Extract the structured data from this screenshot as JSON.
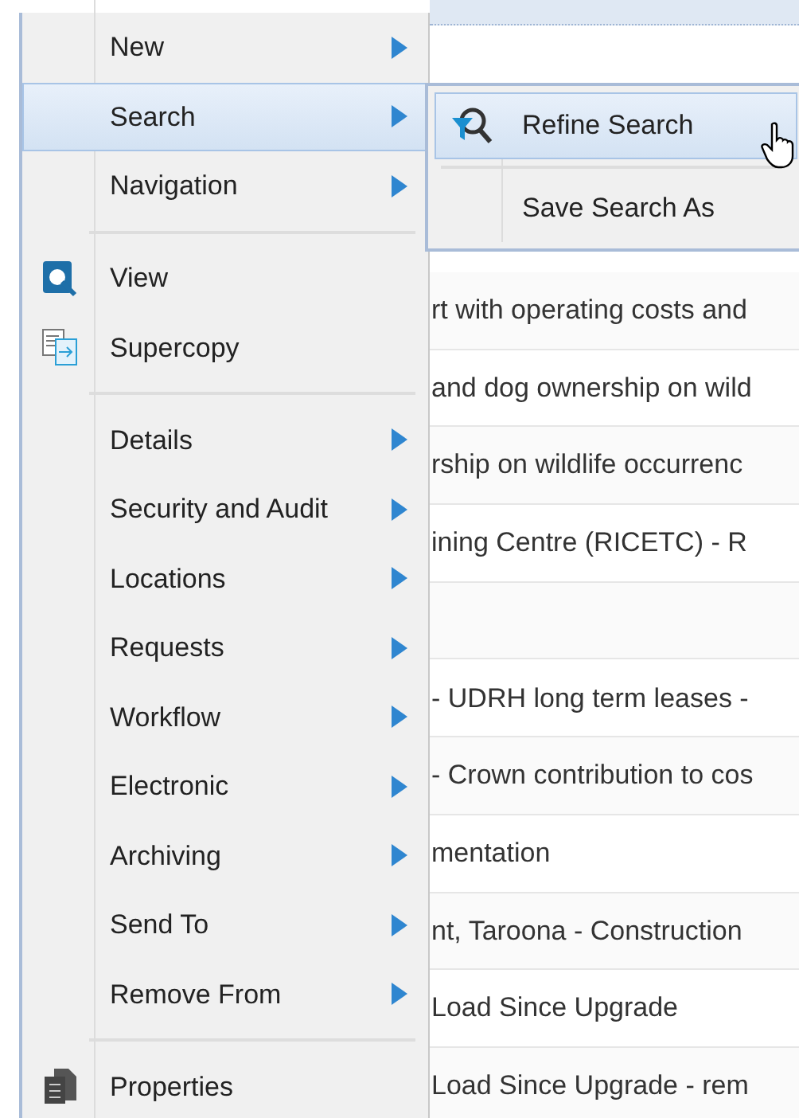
{
  "menu": {
    "items": [
      {
        "kind": "item",
        "label": "New",
        "submenu": true,
        "selected": false
      },
      {
        "kind": "item",
        "label": "Search",
        "submenu": true,
        "selected": true
      },
      {
        "kind": "item",
        "label": "Navigation",
        "submenu": true,
        "selected": false
      },
      {
        "kind": "separator"
      },
      {
        "kind": "view",
        "label": "View",
        "submenu": false,
        "selected": false
      },
      {
        "kind": "copy",
        "label": "Supercopy",
        "submenu": false,
        "selected": false
      },
      {
        "kind": "separator"
      },
      {
        "kind": "item",
        "label": "Details",
        "submenu": true,
        "selected": false
      },
      {
        "kind": "item",
        "label": "Security and Audit",
        "submenu": true,
        "selected": false
      },
      {
        "kind": "item",
        "label": "Locations",
        "submenu": true,
        "selected": false
      },
      {
        "kind": "item",
        "label": "Requests",
        "submenu": true,
        "selected": false
      },
      {
        "kind": "item",
        "label": "Workflow",
        "submenu": true,
        "selected": false
      },
      {
        "kind": "item",
        "label": "Electronic",
        "submenu": true,
        "selected": false
      },
      {
        "kind": "item",
        "label": "Archiving",
        "submenu": true,
        "selected": false
      },
      {
        "kind": "item",
        "label": "Send To",
        "submenu": true,
        "selected": false
      },
      {
        "kind": "item",
        "label": "Remove From",
        "submenu": true,
        "selected": false
      },
      {
        "kind": "separator"
      },
      {
        "kind": "properties",
        "label": "Properties",
        "submenu": false,
        "selected": false
      }
    ]
  },
  "submenu": {
    "items": [
      {
        "kind": "filter",
        "label": "Refine Search",
        "selected": true
      },
      {
        "kind": "separator"
      },
      {
        "kind": "item",
        "label": "Save Search As",
        "selected": false
      }
    ]
  },
  "table": {
    "rows": [
      {
        "text": "rt with operating costs and"
      },
      {
        "text": "and dog ownership on wild"
      },
      {
        "text": "rship on wildlife occurrenc"
      },
      {
        "text": "ining Centre (RICETC) - R"
      },
      {},
      {
        "text": "- UDRH long term leases -"
      },
      {
        "text": "- Crown contribution to cos"
      },
      {
        "text": "mentation"
      },
      {
        "text": "nt, Taroona - Construction"
      },
      {
        "text": "Load Since Upgrade"
      },
      {
        "text": "Load Since Upgrade - rem"
      }
    ]
  }
}
